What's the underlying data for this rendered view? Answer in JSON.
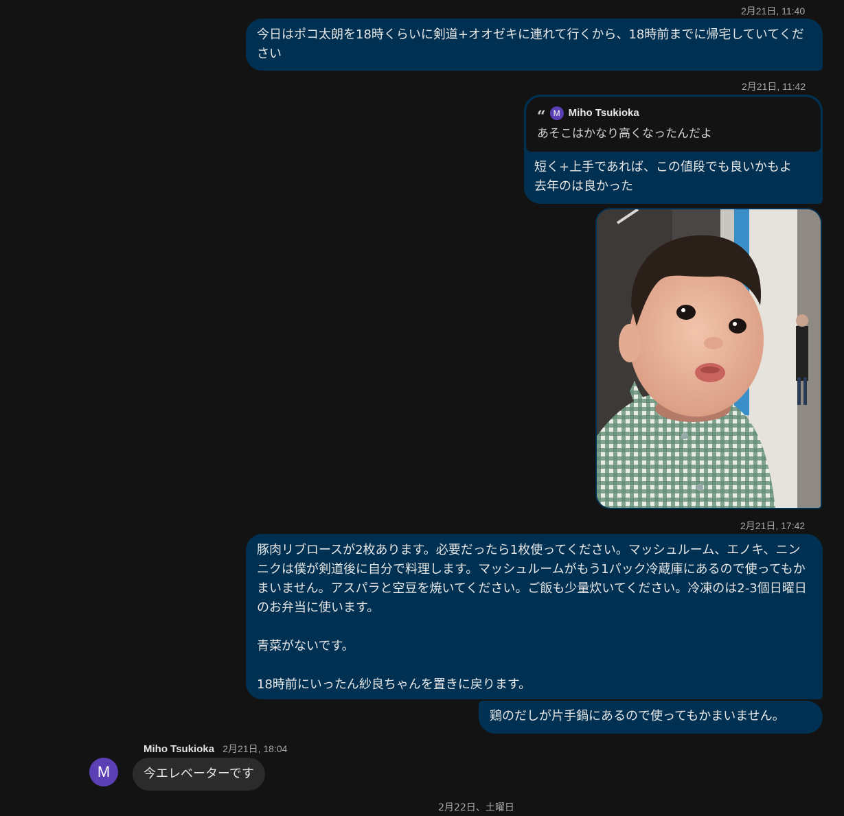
{
  "messages": {
    "m1": {
      "timestamp": "2月21日, 11:40",
      "text": "今日はポコ太朗を18時くらいに剣道+オオゼキに連れて行くから、18時前までに帰宅していてください"
    },
    "m2": {
      "timestamp": "2月21日, 11:42",
      "quote": {
        "mark": "“",
        "avatar_initial": "M",
        "author": "Miho Tsukioka",
        "text": "あそこはかなり高くなったんだよ"
      },
      "line1": "短く+上手であれば、この値段でも良いかもよ",
      "line2": "去年のは良かった"
    },
    "m4": {
      "timestamp": "2月21日, 17:42",
      "text": "豚肉リブロースが2枚あります。必要だったら1枚使ってください。マッシュルーム、エノキ、ニンニクは僕が剣道後に自分で料理します。マッシュルームがもう1パック冷蔵庫にあるので使ってもかまいません。アスパラと空豆を焼いてください。ご飯も少量炊いてください。冷凍のは2-3個日曜日のお弁当に使います。\n\n青菜がないです。\n\n18時前にいったん紗良ちゃんを置きに戻ります。"
    },
    "m5": {
      "text": "鶏のだしが片手鍋にあるので使ってもかまいません。"
    },
    "m6": {
      "sender": "Miho Tsukioka",
      "timestamp": "2月21日, 18:04",
      "avatar_initial": "M",
      "text": "今エレベーターです"
    }
  },
  "date_divider": "2月22日、土曜日",
  "colors": {
    "background": "#131313",
    "outgoing_bubble": "#003152",
    "incoming_bubble": "#2b2b2b",
    "avatar": "#5b3fb5"
  }
}
